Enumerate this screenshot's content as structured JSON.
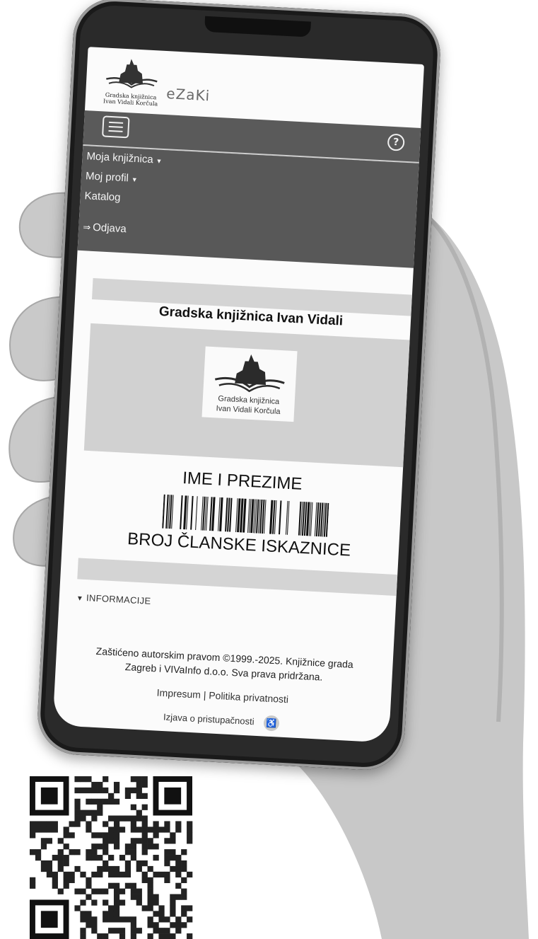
{
  "header": {
    "logo_text_line1": "Gradska knjižnica",
    "logo_text_line2": "Ivan Vidali Korčula",
    "app_name": "eZaKi"
  },
  "navbar": {
    "menu_items": [
      {
        "label": "Moja knjižnica",
        "has_dropdown": true
      },
      {
        "label": "Moj profil",
        "has_dropdown": true
      },
      {
        "label": "Katalog",
        "has_dropdown": false
      }
    ],
    "logout_label": "Odjava",
    "help_icon": "help-circle-icon",
    "menu_icon": "hamburger-menu-icon"
  },
  "card": {
    "library_name": "Gradska knjižnica Ivan Vidali",
    "logo_line1": "Gradska knjižnica",
    "logo_line2": "Ivan Vidali Korčula",
    "member_name": "IME I PREZIME",
    "member_number": "BROJ ČLANSKE ISKAZNICE"
  },
  "info_toggle": "INFORMACIJE",
  "footer": {
    "copyright_line1": "Zaštićeno autorskim pravom ©1999.-2025. Knjižnice grada",
    "copyright_line2": "Zagreb i VIVaInfo d.o.o. Sva prava pridržana.",
    "link_impresum": "Impresum",
    "separator": "|",
    "link_privacy": "Politika privatnosti",
    "accessibility": "Izjava o pristupačnosti"
  },
  "colors": {
    "navbar": "#5a5a5a",
    "panel": "#d1d1d1",
    "text": "#111111"
  }
}
